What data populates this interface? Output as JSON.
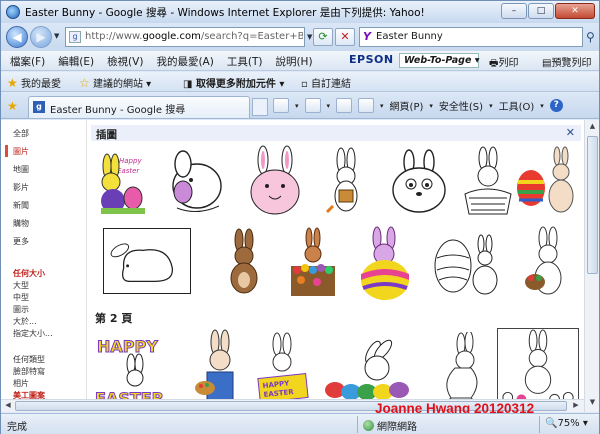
{
  "window": {
    "title": "Easter Bunny - Google 搜尋 - Windows Internet Explorer 是由下列提供: Yahoo!",
    "controls": [
      "–",
      "□",
      "✕"
    ]
  },
  "address": {
    "url_prefix": "http://www.",
    "url_domain": "google.com",
    "url_rest": "/search?q=Easter+Bu",
    "search_query": "Easter Bunny",
    "search_brand_icon": "yahoo-icon"
  },
  "menubar": {
    "items": [
      "檔案(F)",
      "編輯(E)",
      "檢視(V)",
      "我的最愛(A)",
      "工具(T)",
      "說明(H)"
    ],
    "epson": "EPSON",
    "web_to_page": "Web-To-Page",
    "print": "列印",
    "preview": "預覽列印"
  },
  "favorites": {
    "favorites_label": "我的最愛",
    "suggested_sites": "建議的網站",
    "get_addons": "取得更多附加元件",
    "custom_links": "自訂連結"
  },
  "tab": {
    "title": "Easter Bunny - Google 搜尋"
  },
  "commandbar": {
    "page": "網頁(P)",
    "safety": "安全性(S)",
    "tools": "工具(O)",
    "help_icon": "help-icon"
  },
  "leftnav": {
    "items": [
      "全部",
      "圖片",
      "地圖",
      "影片",
      "新聞",
      "購物",
      "更多"
    ],
    "size_heading": "任何大小",
    "sizes": [
      "大型",
      "中型",
      "圖示",
      "大於...",
      "指定大小..."
    ],
    "type_label": "任何類型",
    "types": [
      "臉部特寫",
      "相片",
      "美工圖案"
    ]
  },
  "main": {
    "section_title": "插圖",
    "page_label": "第 2 頁",
    "close_icon": "close-icon"
  },
  "results": {
    "row1": [
      "Happy Easter bunny with pink egg",
      "bunny holding egg",
      "round pink bunny",
      "bunny with carrot basket",
      "big-eyed bunny",
      "bunny with egg basket",
      "bunny with striped egg"
    ],
    "row2": [
      "sleeping bunny outline",
      "brown bunny",
      "bunny in egg basket",
      "bunny in colored egg",
      "decorated egg with bunny",
      "bunny with basket"
    ],
    "row3": [
      "Happy Easter bunny banner",
      "bunny with paint palette",
      "bunny with Happy Easter sign",
      "bunny behind eggs",
      "running bunny",
      "bunny in flower bed"
    ]
  },
  "watermark": "Joanne Hwang 20120312",
  "status": {
    "done": "完成",
    "zone": "網際網路",
    "zoom": "75%"
  }
}
